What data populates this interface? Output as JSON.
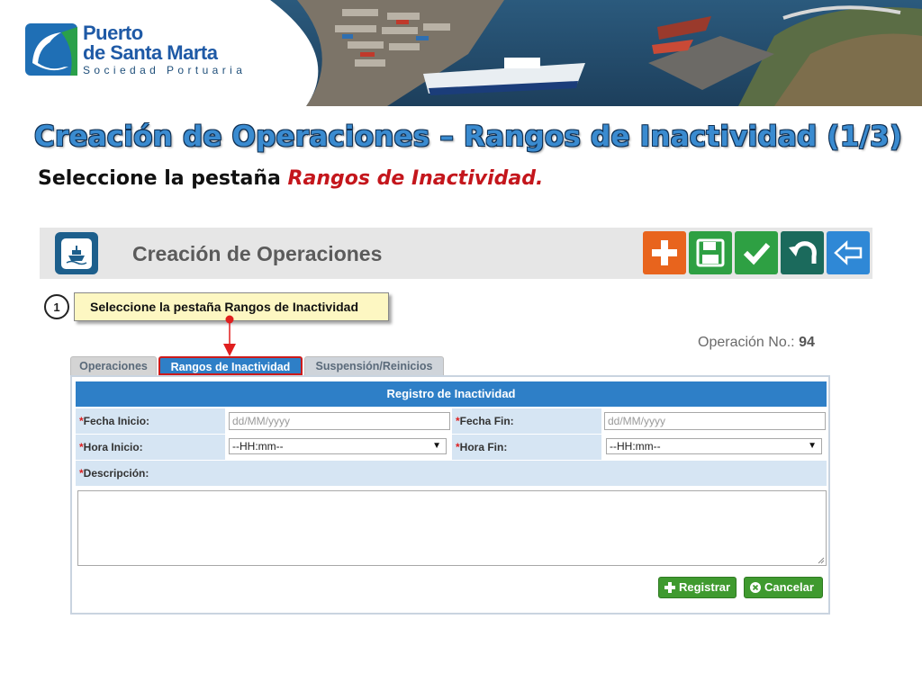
{
  "brand": {
    "line1": "Puerto",
    "line2": "de Santa Marta",
    "line3": "Sociedad Portuaria"
  },
  "slide": {
    "title": "Creación de Operaciones – Rangos de Inactividad (1/3)",
    "subtitle_prefix": "Seleccione la pestaña ",
    "subtitle_emphasis": "Rangos de Inactividad."
  },
  "app": {
    "title": "Creación de Operaciones",
    "toolbar": [
      {
        "name": "add",
        "icon": "plus-icon",
        "color": "#e8641d"
      },
      {
        "name": "save",
        "icon": "floppy-disk-icon",
        "color": "#2ea043"
      },
      {
        "name": "confirm",
        "icon": "checkmark-icon",
        "color": "#2ea043"
      },
      {
        "name": "undo",
        "icon": "undo-icon",
        "color": "#1b6a5c"
      },
      {
        "name": "back",
        "icon": "back-arrow-icon",
        "color": "#2f88d6"
      }
    ]
  },
  "callout": {
    "step": "1",
    "text": "Seleccione la pestaña Rangos de Inactividad"
  },
  "operation": {
    "label": "Operación No.:",
    "number": "94"
  },
  "tabs": [
    {
      "label": "Operaciones",
      "active": false
    },
    {
      "label": "Rangos de Inactividad",
      "active": true
    },
    {
      "label": "Suspensión/Reinicios",
      "active": false
    }
  ],
  "form": {
    "header": "Registro de Inactividad",
    "required_mark": "*",
    "fecha_inicio": {
      "label": "Fecha Inicio:",
      "placeholder": "dd/MM/yyyy"
    },
    "fecha_fin": {
      "label": "Fecha Fin:",
      "placeholder": "dd/MM/yyyy"
    },
    "hora_inicio": {
      "label": "Hora Inicio:",
      "value": "--HH:mm--"
    },
    "hora_fin": {
      "label": "Hora Fin:",
      "value": "--HH:mm--"
    },
    "descripcion": {
      "label": "Descripción:"
    },
    "register_label": "Registrar",
    "cancel_label": "Cancelar"
  }
}
